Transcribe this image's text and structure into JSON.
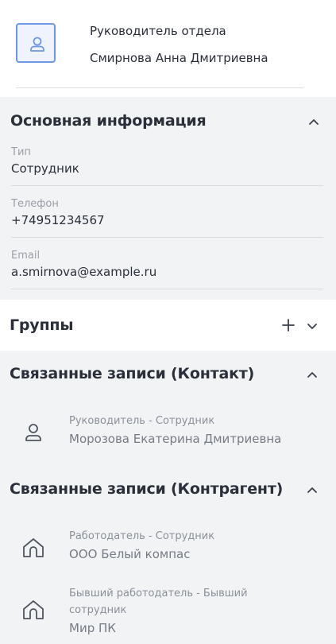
{
  "header": {
    "role": "Руководитель отдела",
    "name": "Смирнова Анна Дмитриевна",
    "avatar_icon": "user-icon"
  },
  "main_info": {
    "title": "Основная информация",
    "collapse_icon": "chevron-up-icon",
    "fields": [
      {
        "label": "Тип",
        "value": "Сотрудник"
      },
      {
        "label": "Телефон",
        "value": "+74951234567"
      },
      {
        "label": "Email",
        "value": "a.smirnova@example.ru"
      }
    ]
  },
  "groups": {
    "title": "Группы",
    "add_icon": "plus-icon",
    "expand_icon": "chevron-down-icon"
  },
  "related_contact": {
    "title": "Связанные записи (Контакт)",
    "collapse_icon": "chevron-up-icon",
    "items": [
      {
        "icon": "user-icon",
        "role": "Руководитель - Сотрудник",
        "name": "Морозова Екатерина Дмитриевна"
      }
    ]
  },
  "related_counterparty": {
    "title": "Связанные записи (Контрагент)",
    "collapse_icon": "chevron-up-icon",
    "items": [
      {
        "icon": "home-icon",
        "role": "Работодатель - Сотрудник",
        "name": "ООО Белый компас"
      },
      {
        "icon": "home-icon",
        "role_line1": "Бывший работодатель - Бывший",
        "role_line2": "сотрудник",
        "name": "Мир ПК"
      }
    ]
  },
  "colors": {
    "accent": "#6f97e6",
    "section_bg": "#f2f3f5",
    "text": "#2b2f3a",
    "muted": "#9a9ea6"
  }
}
